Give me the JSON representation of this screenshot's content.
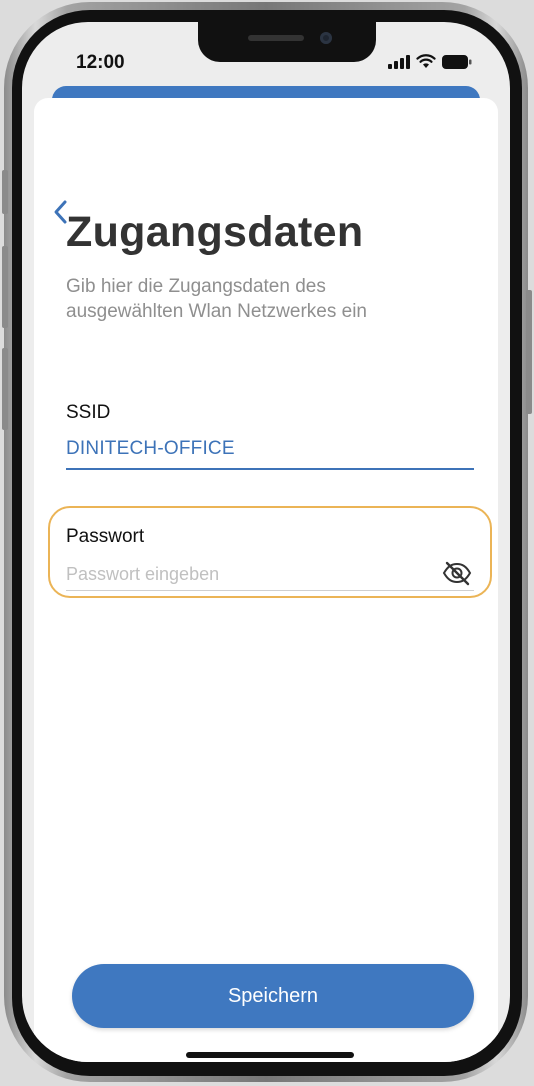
{
  "status_bar": {
    "time": "12:00",
    "icons": [
      "cellular-signal-icon",
      "wifi-icon",
      "battery-icon"
    ]
  },
  "navigation": {
    "back_icon": "chevron-left-icon"
  },
  "header": {
    "title": "Zugangsdaten",
    "subtitle": "Gib hier die Zugangsdaten des ausgewählten Wlan Netzwerkes ein"
  },
  "form": {
    "ssid_label": "SSID",
    "ssid_value": "DINITECH-OFFICE",
    "password_label": "Passwort",
    "password_placeholder": "Passwort eingeben",
    "password_value": "",
    "visibility_icon": "eye-slash-icon"
  },
  "actions": {
    "save_label": "Speichern"
  },
  "colors": {
    "accent": "#3f78c0",
    "highlight": "#ebb456",
    "title_text": "#333333",
    "subtitle_text": "#8f8f8f"
  }
}
